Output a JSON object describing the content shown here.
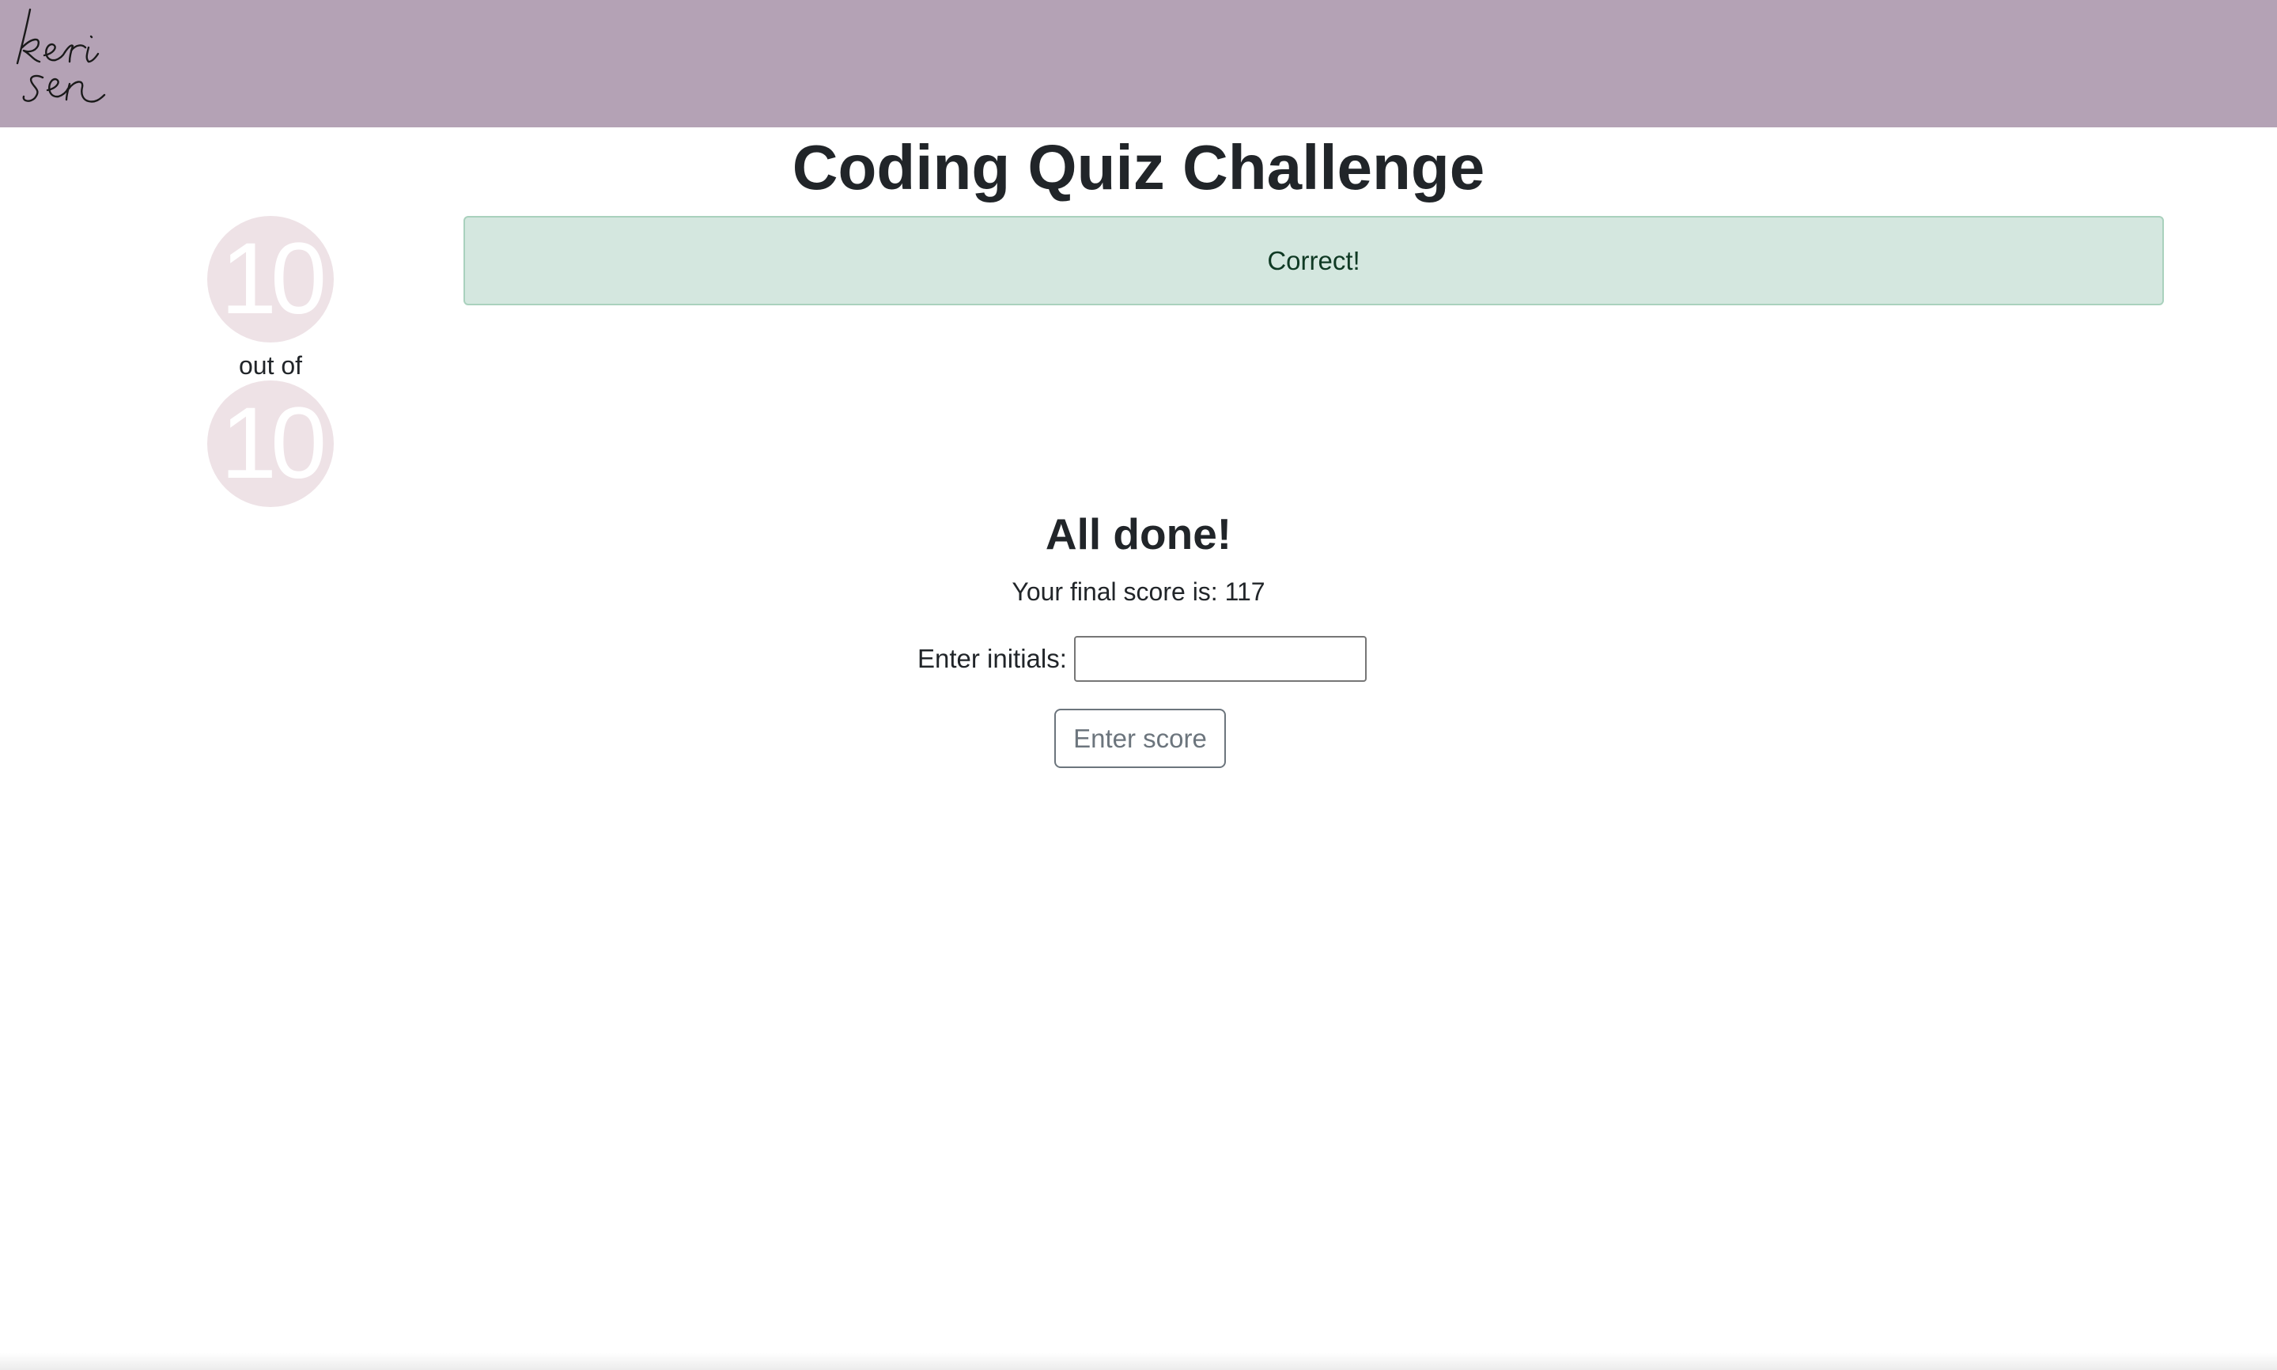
{
  "header": {
    "logo_text": "keri sen",
    "background_color": "#b4a2b5"
  },
  "page_title": "Coding Quiz Challenge",
  "counter": {
    "correct": "10",
    "separator": "out of",
    "total": "10",
    "circle_color": "#eee2e6"
  },
  "feedback": {
    "message": "Correct!",
    "status": "success",
    "color": "#d4e7df"
  },
  "results": {
    "heading": "All done!",
    "score_label": "Your final score is: ",
    "score_value": "117",
    "initials_label": "Enter initials:",
    "initials_value": "",
    "submit_label": "Enter score"
  }
}
